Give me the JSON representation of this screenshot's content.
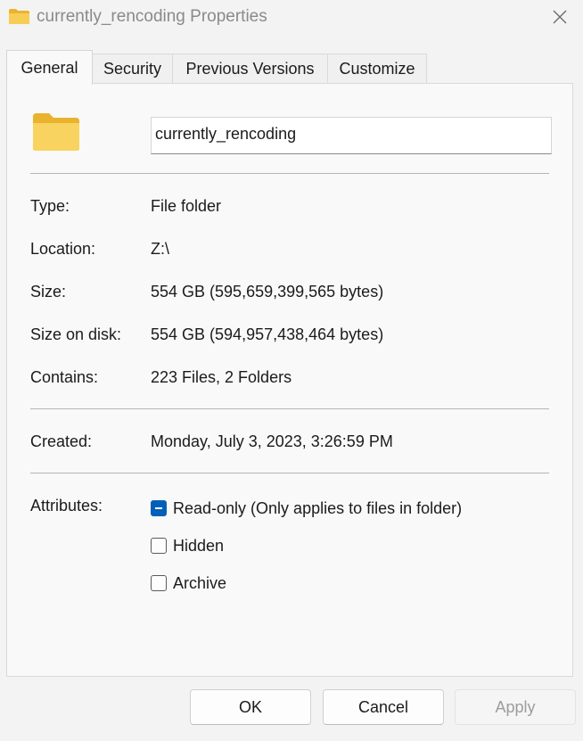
{
  "window": {
    "title": "currently_rencoding Properties",
    "close_icon": "close-icon"
  },
  "tabs": [
    {
      "label": "General",
      "active": true
    },
    {
      "label": "Security",
      "active": false
    },
    {
      "label": "Previous Versions",
      "active": false
    },
    {
      "label": "Customize",
      "active": false
    }
  ],
  "general": {
    "folder_icon": "folder-icon",
    "name_value": "currently_rencoding",
    "type": {
      "label": "Type:",
      "value": "File folder"
    },
    "location": {
      "label": "Location:",
      "value": "Z:\\"
    },
    "size": {
      "label": "Size:",
      "value": "554 GB (595,659,399,565 bytes)"
    },
    "size_on_disk": {
      "label": "Size on disk:",
      "value": "554 GB (594,957,438,464 bytes)"
    },
    "contains": {
      "label": "Contains:",
      "value": "223 Files, 2 Folders"
    },
    "created": {
      "label": "Created:",
      "value": "Monday, July 3, 2023, 3:26:59 PM"
    },
    "attributes": {
      "label": "Attributes:",
      "read_only": {
        "label": "Read-only (Only applies to files in folder)",
        "state": "indeterminate"
      },
      "hidden": {
        "label": "Hidden",
        "state": "unchecked"
      },
      "archive": {
        "label": "Archive",
        "state": "unchecked"
      }
    }
  },
  "buttons": {
    "ok": "OK",
    "cancel": "Cancel",
    "apply": "Apply",
    "apply_disabled": true
  },
  "colors": {
    "accent": "#005fb8",
    "folder_yellow": "#f8c94a"
  }
}
